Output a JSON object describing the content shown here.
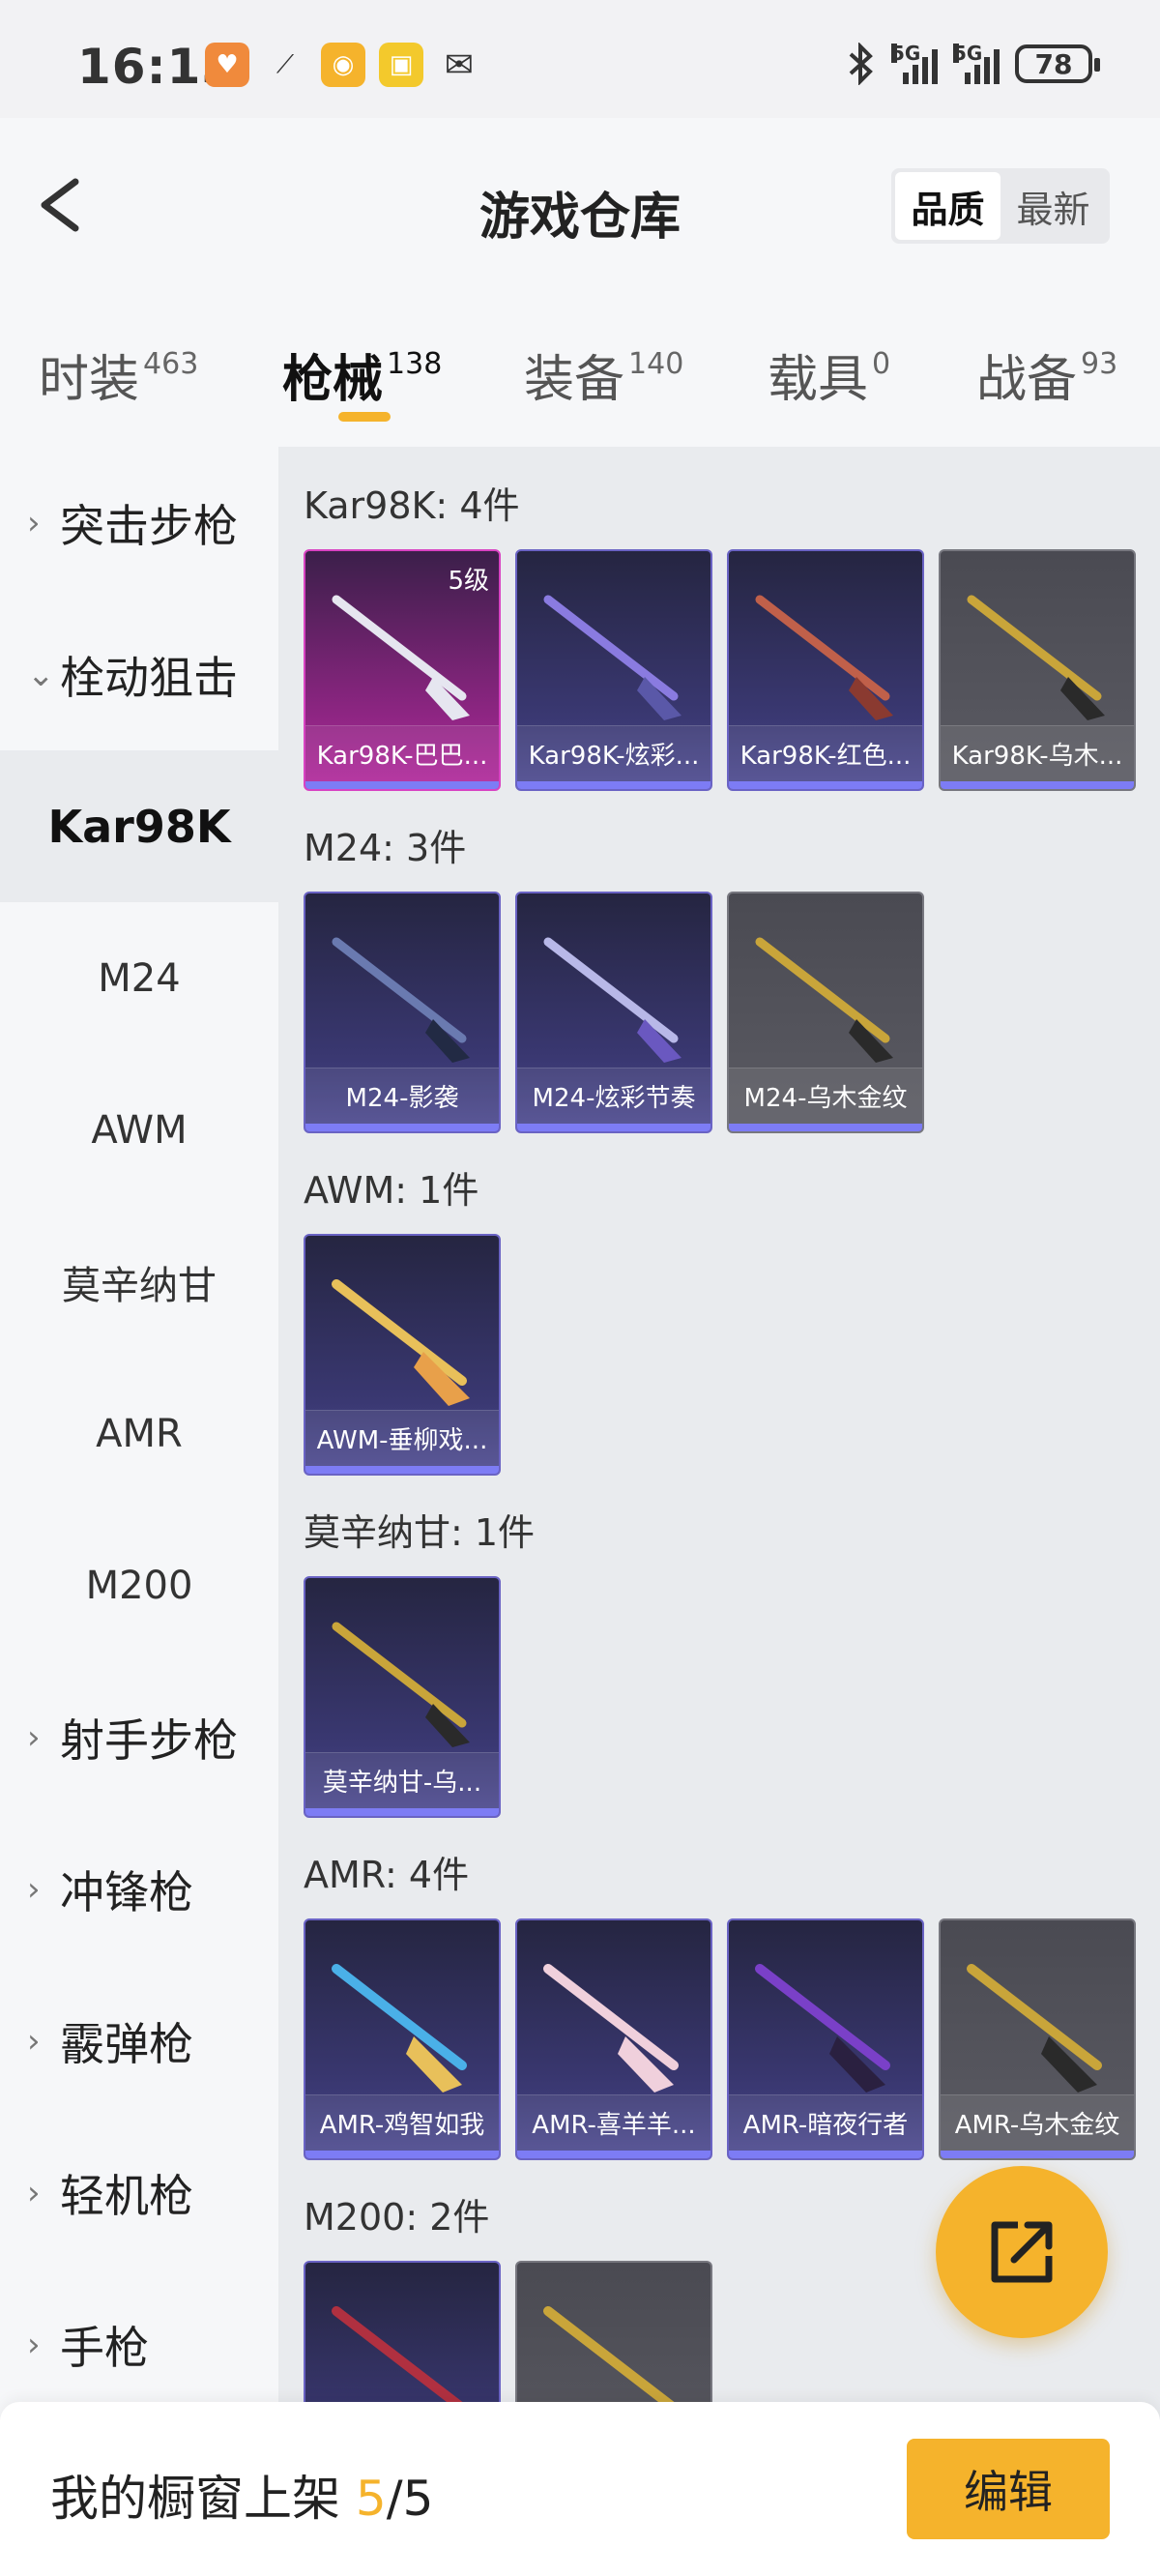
{
  "status_bar": {
    "time": "16:13",
    "signal1_label": "5G",
    "signal2_label": "5G",
    "battery": "78"
  },
  "header": {
    "title": "游戏仓库",
    "sort_options": [
      "品质",
      "最新"
    ]
  },
  "tabs": [
    {
      "label": "时装",
      "count": "463"
    },
    {
      "label": "枪械",
      "count": "138"
    },
    {
      "label": "装备",
      "count": "140"
    },
    {
      "label": "载具",
      "count": "0"
    },
    {
      "label": "战备",
      "count": "93"
    }
  ],
  "sidebar": {
    "items": [
      {
        "label": "突击步枪"
      },
      {
        "label": "栓动狙击"
      },
      {
        "label": "Kar98K"
      },
      {
        "label": "M24"
      },
      {
        "label": "AWM"
      },
      {
        "label": "莫辛纳甘"
      },
      {
        "label": "AMR"
      },
      {
        "label": "M200"
      },
      {
        "label": "射手步枪"
      },
      {
        "label": "冲锋枪"
      },
      {
        "label": "霰弹枪"
      },
      {
        "label": "轻机枪"
      },
      {
        "label": "手枪"
      }
    ]
  },
  "groups": [
    {
      "title": "Kar98K: 4件",
      "items": [
        {
          "name": "Kar98K-巴巴...",
          "level": "5级"
        },
        {
          "name": "Kar98K-炫彩..."
        },
        {
          "name": "Kar98K-红色..."
        },
        {
          "name": "Kar98K-乌木..."
        }
      ]
    },
    {
      "title": "M24: 3件",
      "items": [
        {
          "name": "M24-影袭"
        },
        {
          "name": "M24-炫彩节奏"
        },
        {
          "name": "M24-乌木金纹"
        }
      ]
    },
    {
      "title": "AWM: 1件",
      "items": [
        {
          "name": "AWM-垂柳戏..."
        }
      ]
    },
    {
      "title": "莫辛纳甘: 1件",
      "items": [
        {
          "name": "莫辛纳甘-乌..."
        }
      ]
    },
    {
      "title": "AMR: 4件",
      "items": [
        {
          "name": "AMR-鸡智如我"
        },
        {
          "name": "AMR-喜羊羊..."
        },
        {
          "name": "AMR-暗夜行者"
        },
        {
          "name": "AMR-乌木金纹"
        }
      ]
    },
    {
      "title": "M200: 2件",
      "items": [
        {
          "name": ""
        },
        {
          "name": ""
        }
      ]
    }
  ],
  "bottom": {
    "shelf_label": "我的橱窗上架",
    "shelf_current": "5",
    "shelf_total": "/5",
    "edit_label": "编辑"
  },
  "colors": {
    "accent": "#f5b32c",
    "card_purple": "#3a3872",
    "card_pink": "#b3289c",
    "card_gray": "#5b5b63"
  }
}
